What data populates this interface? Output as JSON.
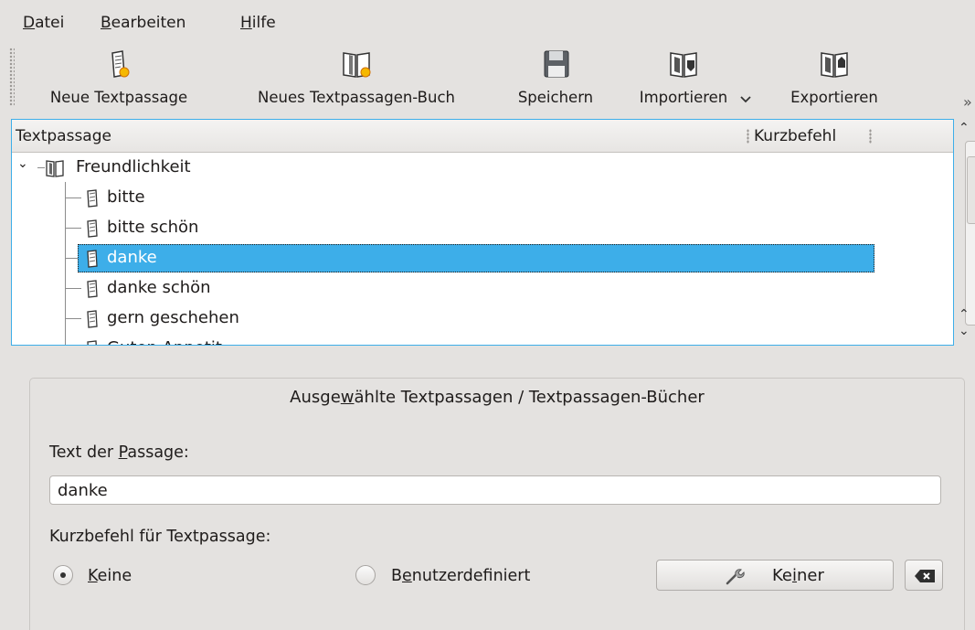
{
  "menubar": {
    "items": [
      {
        "label": "Datei",
        "mnemonic": "D",
        "rest": "atei"
      },
      {
        "label": "Bearbeiten",
        "mnemonic": "B",
        "rest": "earbeiten"
      },
      {
        "label": "Hilfe",
        "mnemonic": "H",
        "rest": "ilfe"
      }
    ]
  },
  "toolbar": {
    "new_phrase": "Neue Textpassage",
    "new_book": "Neues Textpassagen-Buch",
    "save": "Speichern",
    "import": "Importieren",
    "export": "Exportieren",
    "overflow_glyph": "»"
  },
  "tree": {
    "columns": [
      "Textpassage",
      "Kurzbefehl"
    ],
    "book": "Freundlichkeit",
    "items": [
      "bitte",
      "bitte schön",
      "danke",
      "danke schön",
      "gern geschehen",
      "Guten Appetit"
    ],
    "selected_index": 2
  },
  "details": {
    "group_title_pre": "Ausge",
    "group_title_mnemonic": "w",
    "group_title_post": "ählte Textpassagen / Textpassagen-Bücher",
    "phrase_label_pre": "Text der ",
    "phrase_label_mnemonic": "P",
    "phrase_label_post": "assage:",
    "phrase_value": "danke",
    "shortcut_label": "Kurzbefehl für Textpassage:",
    "radio_none_mnemonic": "K",
    "radio_none_rest": "eine",
    "radio_custom_pre": "B",
    "radio_custom_mnemonic": "e",
    "radio_custom_post": "nutzerdefiniert",
    "key_button_pre": "Ke",
    "key_button_mnemonic": "i",
    "key_button_post": "ner",
    "radio_selected": "none"
  },
  "colors": {
    "selection": "#3daee9",
    "window_bg": "#e4e2e0"
  },
  "icons": [
    "phrase-new-icon",
    "book-new-icon",
    "floppy-save-icon",
    "import-icon",
    "export-icon",
    "book-icon",
    "phrase-icon",
    "wrench-icon",
    "clear-left-icon",
    "chevron-down-icon"
  ]
}
